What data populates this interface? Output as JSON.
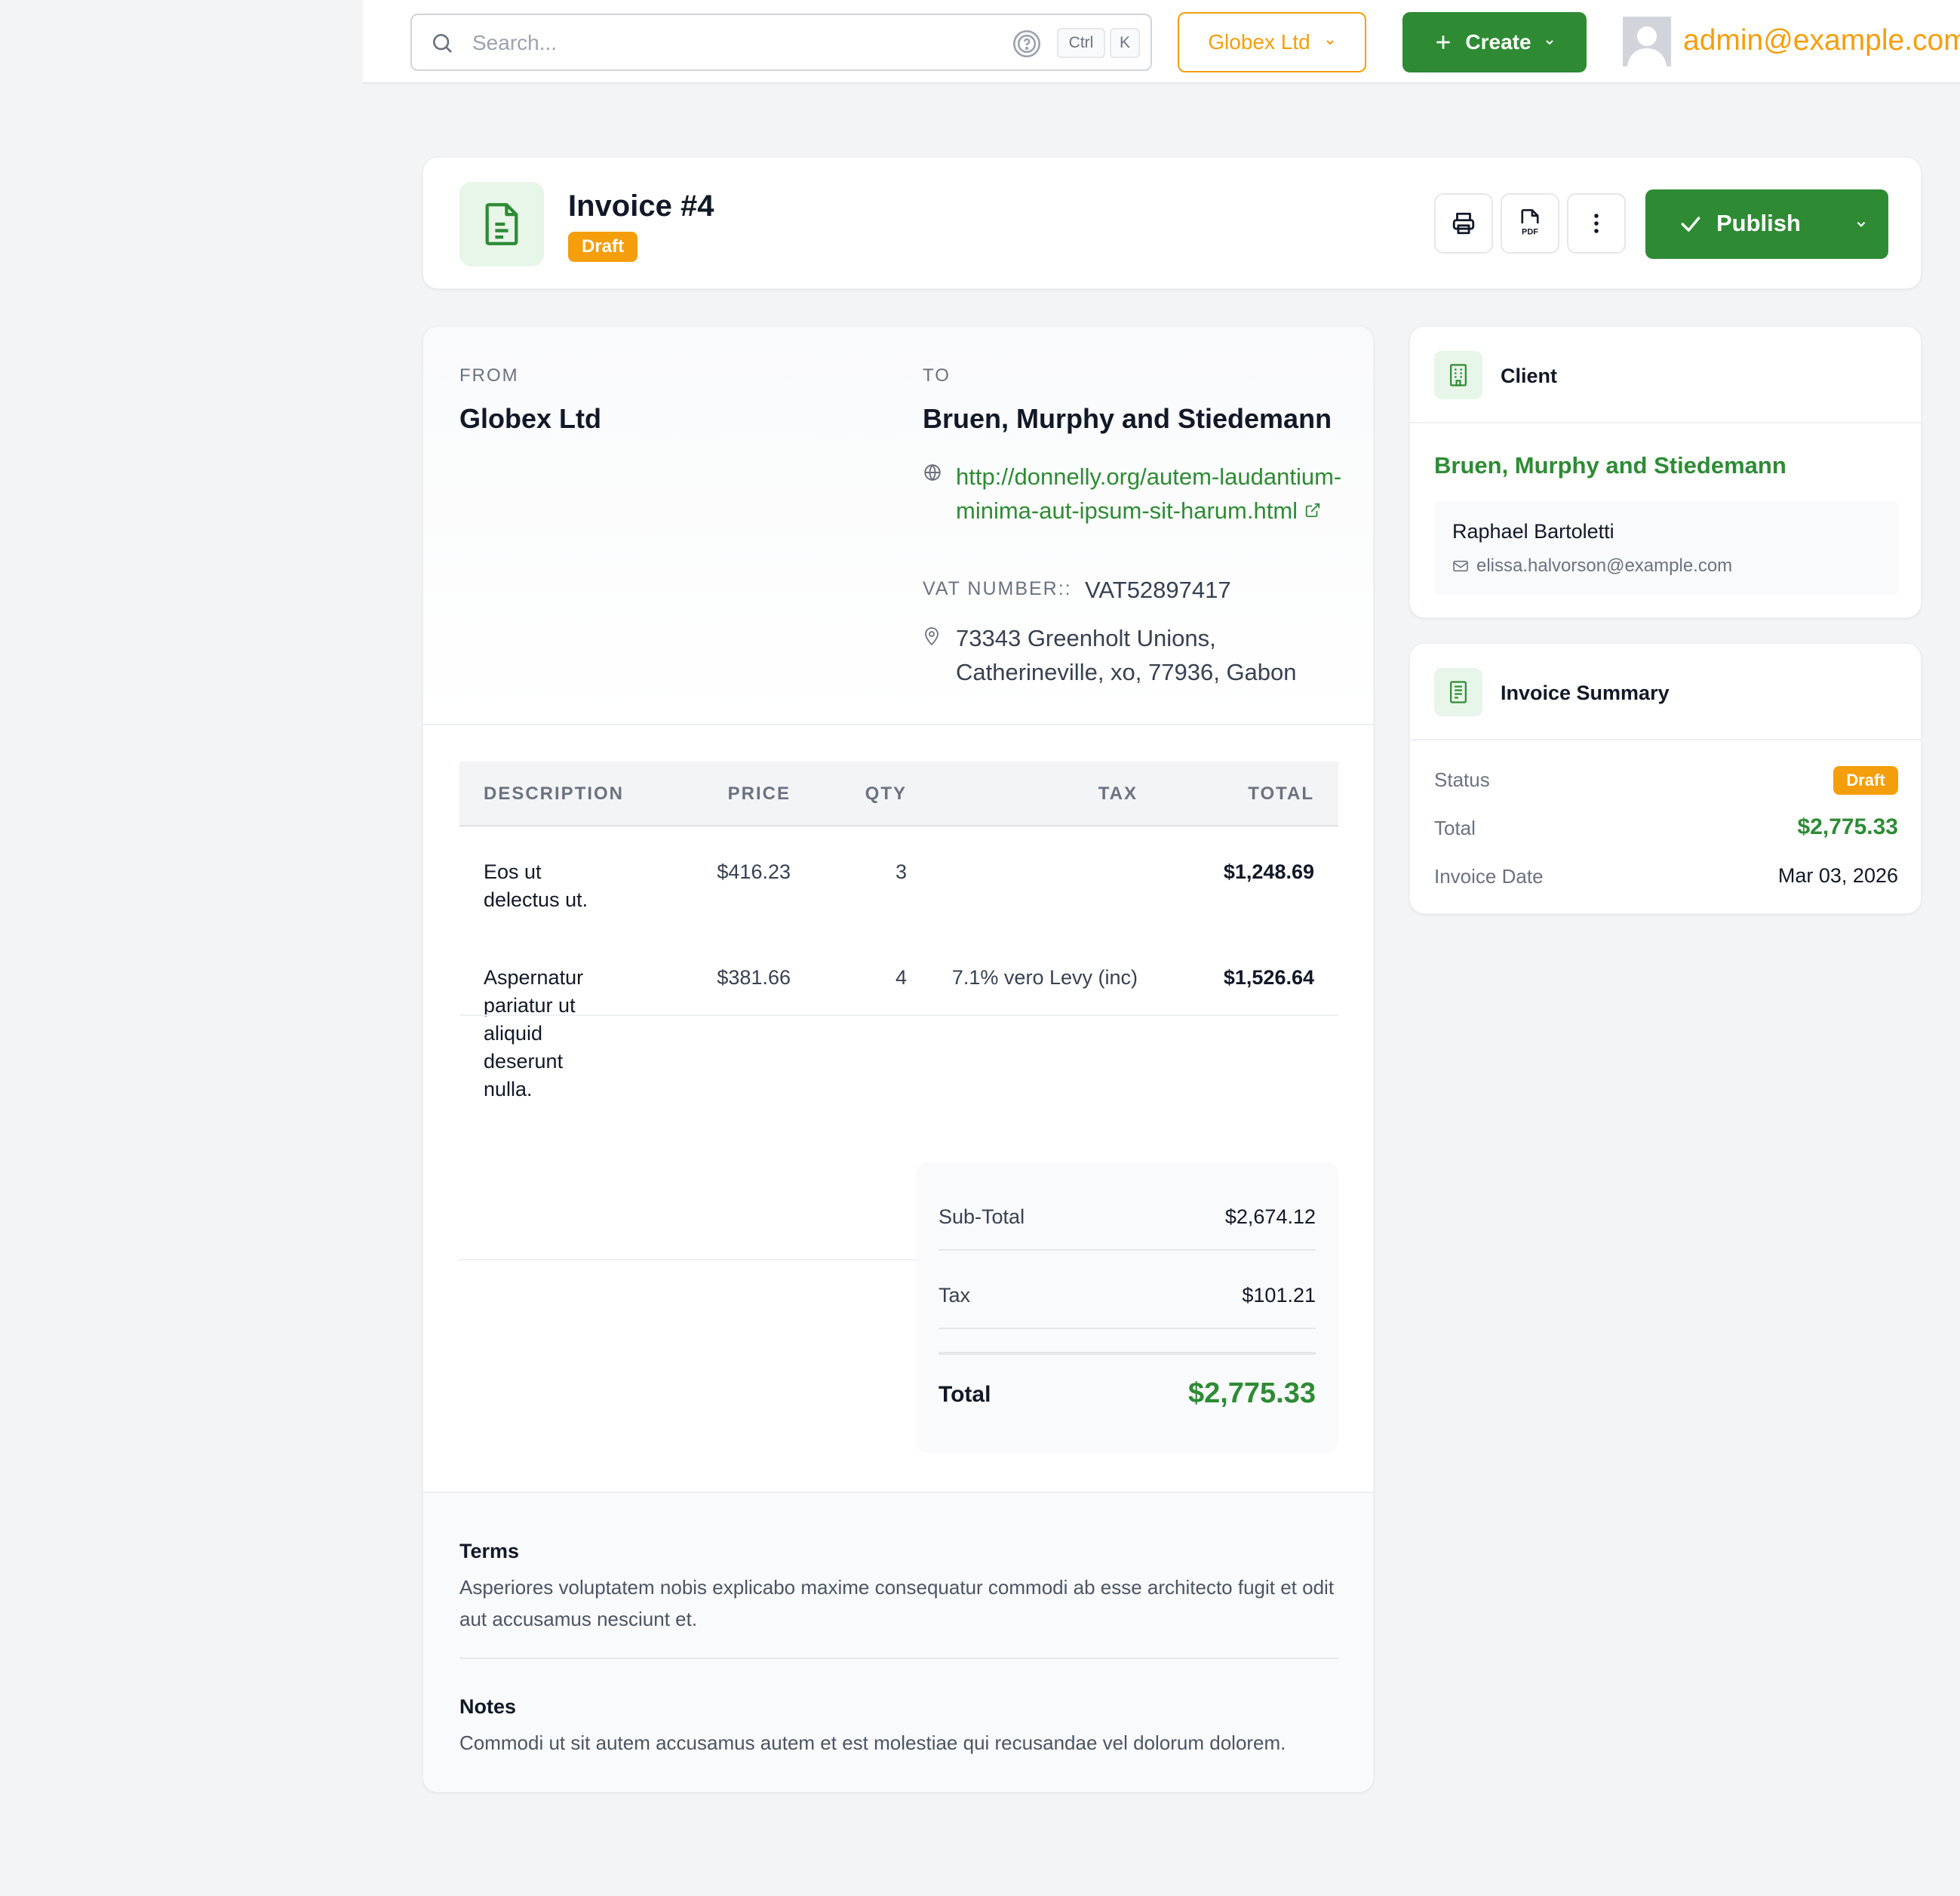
{
  "topbar": {
    "search_placeholder": "Search...",
    "kbd_ctrl": "Ctrl",
    "kbd_k": "K",
    "company": "Globex Ltd",
    "create_label": "Create",
    "user_email": "admin@example.com"
  },
  "header": {
    "title": "Invoice #4",
    "status": "Draft",
    "publish_label": "Publish"
  },
  "invoice": {
    "from_label": "FROM",
    "from_name": "Globex Ltd",
    "to_label": "TO",
    "to_name": "Bruen, Murphy and Stiedemann",
    "website": "http://donnelly.org/autem-laudantium-minima-aut-ipsum-sit-harum.html",
    "vat_label": "VAT NUMBER::",
    "vat_number": "VAT52897417",
    "address": "73343 Greenholt Unions, Catherineville, xo, 77936, Gabon"
  },
  "table": {
    "headers": {
      "description": "DESCRIPTION",
      "price": "PRICE",
      "qty": "QTY",
      "tax": "TAX",
      "total": "TOTAL"
    },
    "rows": [
      {
        "description": "Eos ut delectus ut.",
        "price": "$416.23",
        "qty": "3",
        "tax": "",
        "total": "$1,248.69"
      },
      {
        "description": "Aspernatur pariatur ut aliquid deserunt nulla.",
        "price": "$381.66",
        "qty": "4",
        "tax": "7.1% vero Levy (inc)",
        "total": "$1,526.64"
      }
    ]
  },
  "totals": {
    "subtotal_label": "Sub-Total",
    "subtotal": "$2,674.12",
    "tax_label": "Tax",
    "tax": "$101.21",
    "total_label": "Total",
    "total": "$2,775.33"
  },
  "terms": {
    "title": "Terms",
    "body": "Asperiores voluptatem nobis explicabo maxime consequatur commodi ab esse architecto fugit et odit aut accusamus nesciunt et."
  },
  "notes": {
    "title": "Notes",
    "body": "Commodi ut sit autem accusamus autem et est molestiae qui recusandae vel dolorum dolorem."
  },
  "client_card": {
    "title": "Client",
    "client_name": "Bruen, Murphy and Stiedemann",
    "contact_name": "Raphael Bartoletti",
    "contact_email": "elissa.halvorson@example.com"
  },
  "summary_card": {
    "title": "Invoice Summary",
    "status_label": "Status",
    "status": "Draft",
    "total_label": "Total",
    "total": "$2,775.33",
    "date_label": "Invoice Date",
    "date": "Mar 03, 2026"
  },
  "colors": {
    "primary_green": "#2e8b34",
    "accent_amber": "#f59e0b",
    "page_bg": "#f3f4f6"
  }
}
